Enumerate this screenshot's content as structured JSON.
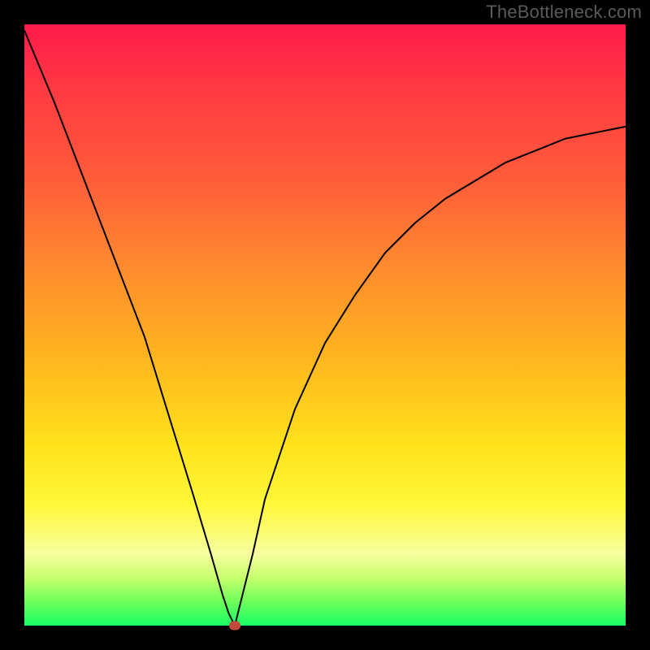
{
  "watermark": "TheBottleneck.com",
  "chart_data": {
    "type": "line",
    "title": "",
    "xlabel": "",
    "ylabel": "",
    "xlim": [
      0,
      100
    ],
    "ylim": [
      0,
      100
    ],
    "grid": false,
    "legend": false,
    "series": [
      {
        "name": "bottleneck-curve",
        "color": "#000000",
        "x": [
          0,
          5,
          10,
          15,
          20,
          24,
          28,
          31,
          33,
          34,
          35,
          36,
          38,
          40,
          45,
          50,
          55,
          60,
          65,
          70,
          75,
          80,
          85,
          90,
          95,
          100
        ],
        "values": [
          99,
          87,
          74,
          61,
          48,
          35,
          22,
          12,
          5,
          2,
          0,
          4,
          12,
          21,
          36,
          47,
          55,
          62,
          67,
          71,
          74,
          77,
          79,
          81,
          82,
          83
        ]
      }
    ],
    "annotations": [
      {
        "name": "optimal-point",
        "x": 35,
        "y": 0,
        "shape": "dot",
        "color": "#c24a3a"
      }
    ],
    "background_gradient": {
      "direction": "vertical",
      "stops": [
        {
          "pos": 0.0,
          "color": "#ff1a4b"
        },
        {
          "pos": 0.25,
          "color": "#ff5a3a"
        },
        {
          "pos": 0.55,
          "color": "#ffb41f"
        },
        {
          "pos": 0.8,
          "color": "#fff83a"
        },
        {
          "pos": 0.92,
          "color": "#c8ff6e"
        },
        {
          "pos": 1.0,
          "color": "#17ff66"
        }
      ]
    }
  }
}
